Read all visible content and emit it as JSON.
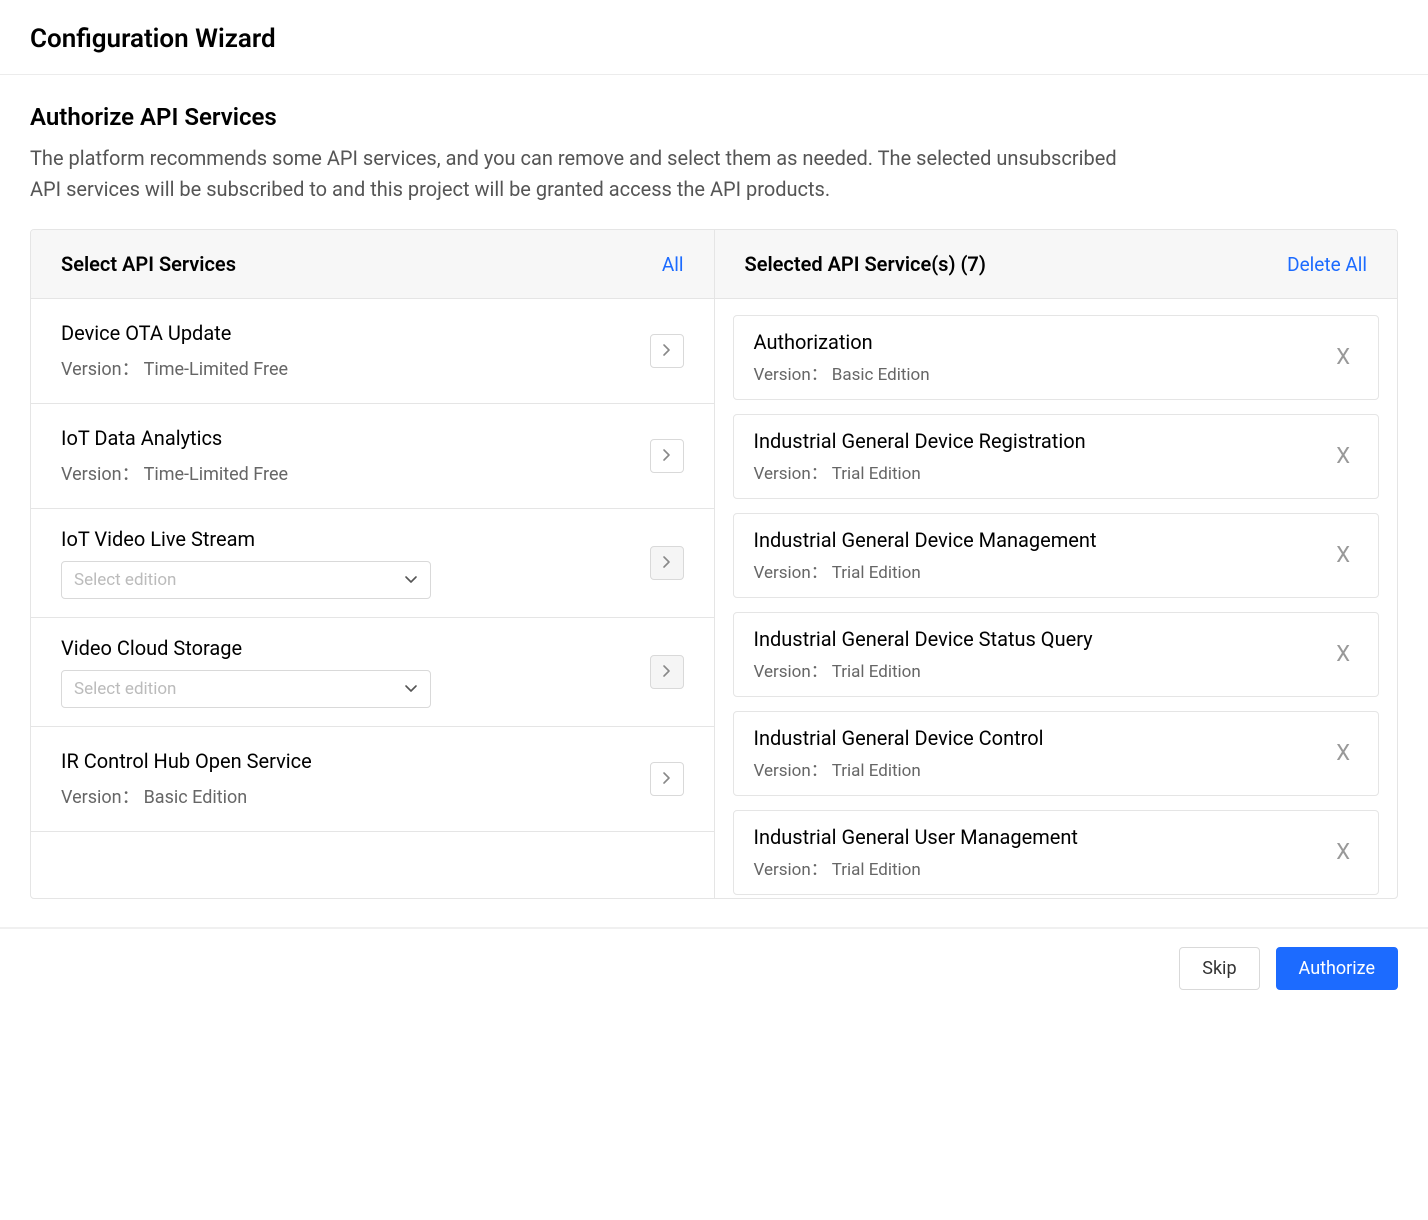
{
  "page_title": "Configuration Wizard",
  "section": {
    "heading": "Authorize API Services",
    "description": "The platform recommends some API services, and you can remove and select them as needed. The selected unsubscribed API services will be subscribed to and this project will be granted access the API products."
  },
  "left_panel": {
    "title": "Select API Services",
    "action": "All",
    "version_label": "Version",
    "select_placeholder": "Select edition",
    "items": [
      {
        "title": "Device OTA Update",
        "version": "Time-Limited Free",
        "has_select": false,
        "move_enabled": true
      },
      {
        "title": "IoT Data Analytics",
        "version": "Time-Limited Free",
        "has_select": false,
        "move_enabled": true
      },
      {
        "title": "IoT Video Live Stream",
        "version": null,
        "has_select": true,
        "move_enabled": false
      },
      {
        "title": "Video Cloud Storage",
        "version": null,
        "has_select": true,
        "move_enabled": false
      },
      {
        "title": "IR Control Hub Open Service",
        "version": "Basic Edition",
        "has_select": false,
        "move_enabled": true
      }
    ]
  },
  "right_panel": {
    "title": "Selected API Service(s) (7)",
    "action": "Delete All",
    "version_label": "Version",
    "items": [
      {
        "title": "Authorization",
        "version": "Basic Edition"
      },
      {
        "title": "Industrial General Device Registration",
        "version": "Trial Edition"
      },
      {
        "title": "Industrial General Device Management",
        "version": "Trial Edition"
      },
      {
        "title": "Industrial General Device Status Query",
        "version": "Trial Edition"
      },
      {
        "title": "Industrial General Device Control",
        "version": "Trial Edition"
      },
      {
        "title": "Industrial General User Management",
        "version": "Trial Edition"
      }
    ]
  },
  "footer": {
    "skip": "Skip",
    "authorize": "Authorize"
  }
}
